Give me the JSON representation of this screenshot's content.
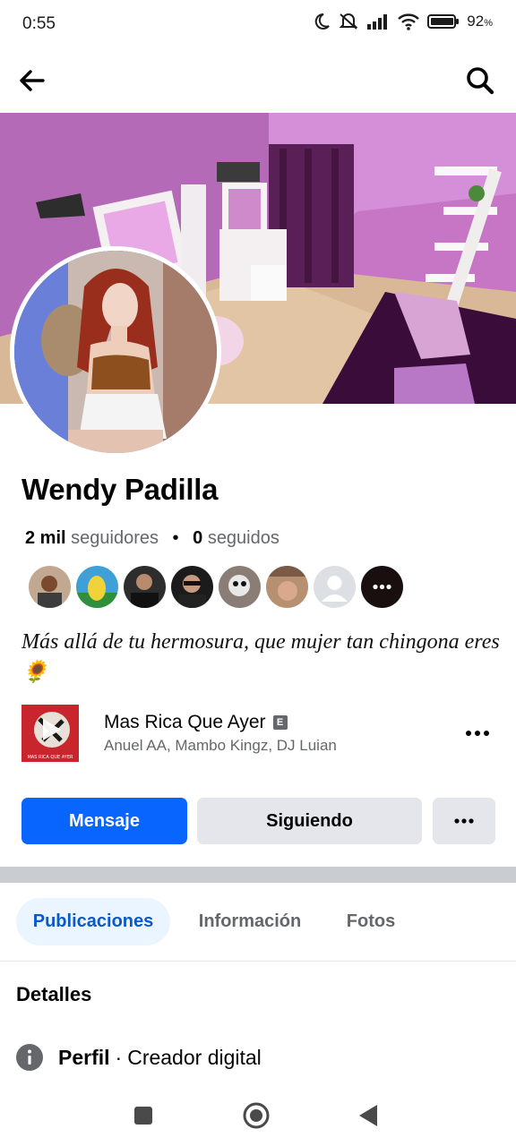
{
  "status_bar": {
    "time": "0:55",
    "battery_percent": "92",
    "battery_unit": "%",
    "icons": [
      "moon-icon",
      "mute-icon",
      "signal-icon",
      "wifi-icon",
      "battery-icon"
    ]
  },
  "top_bar": {
    "back_icon": "back-arrow-icon",
    "search_icon": "search-icon"
  },
  "profile": {
    "name": "Wendy Padilla",
    "followers_count": "2 mil",
    "followers_label": "seguidores",
    "separator": "•",
    "following_count": "0",
    "following_label": "seguidos",
    "friends_more_icon": "more-horizontal-icon",
    "bio": "Más allá de tu hermosura, que mujer tan chingona eres",
    "bio_emoji": "🌻"
  },
  "music": {
    "title": "Mas Rica Que Ayer",
    "explicit_badge": "E",
    "artists": "Anuel AA, Mambo Kingz, DJ Luian",
    "album_caption": "MAS RICA QUE AYER",
    "more_icon": "more-horizontal-icon"
  },
  "actions": {
    "message_label": "Mensaje",
    "following_label": "Siguiendo",
    "more_icon": "more-horizontal-icon"
  },
  "tabs": [
    {
      "label": "Publicaciones",
      "active": true
    },
    {
      "label": "Información",
      "active": false
    },
    {
      "label": "Fotos",
      "active": false
    }
  ],
  "details": {
    "title": "Detalles",
    "row_label": "Perfil",
    "row_separator": "·",
    "row_value": "Creador digital",
    "row_icon": "info-icon"
  },
  "colors": {
    "primary_blue": "#0866ff",
    "button_gray": "#e4e6eb",
    "active_tab_bg": "#ebf5ff",
    "active_tab_text": "#0a58ca",
    "muted_text": "#65676b",
    "cover_pink": "#d27fcf"
  },
  "nav_bar": {
    "icons": [
      "recents-square-icon",
      "home-circle-icon",
      "back-triangle-icon"
    ]
  }
}
